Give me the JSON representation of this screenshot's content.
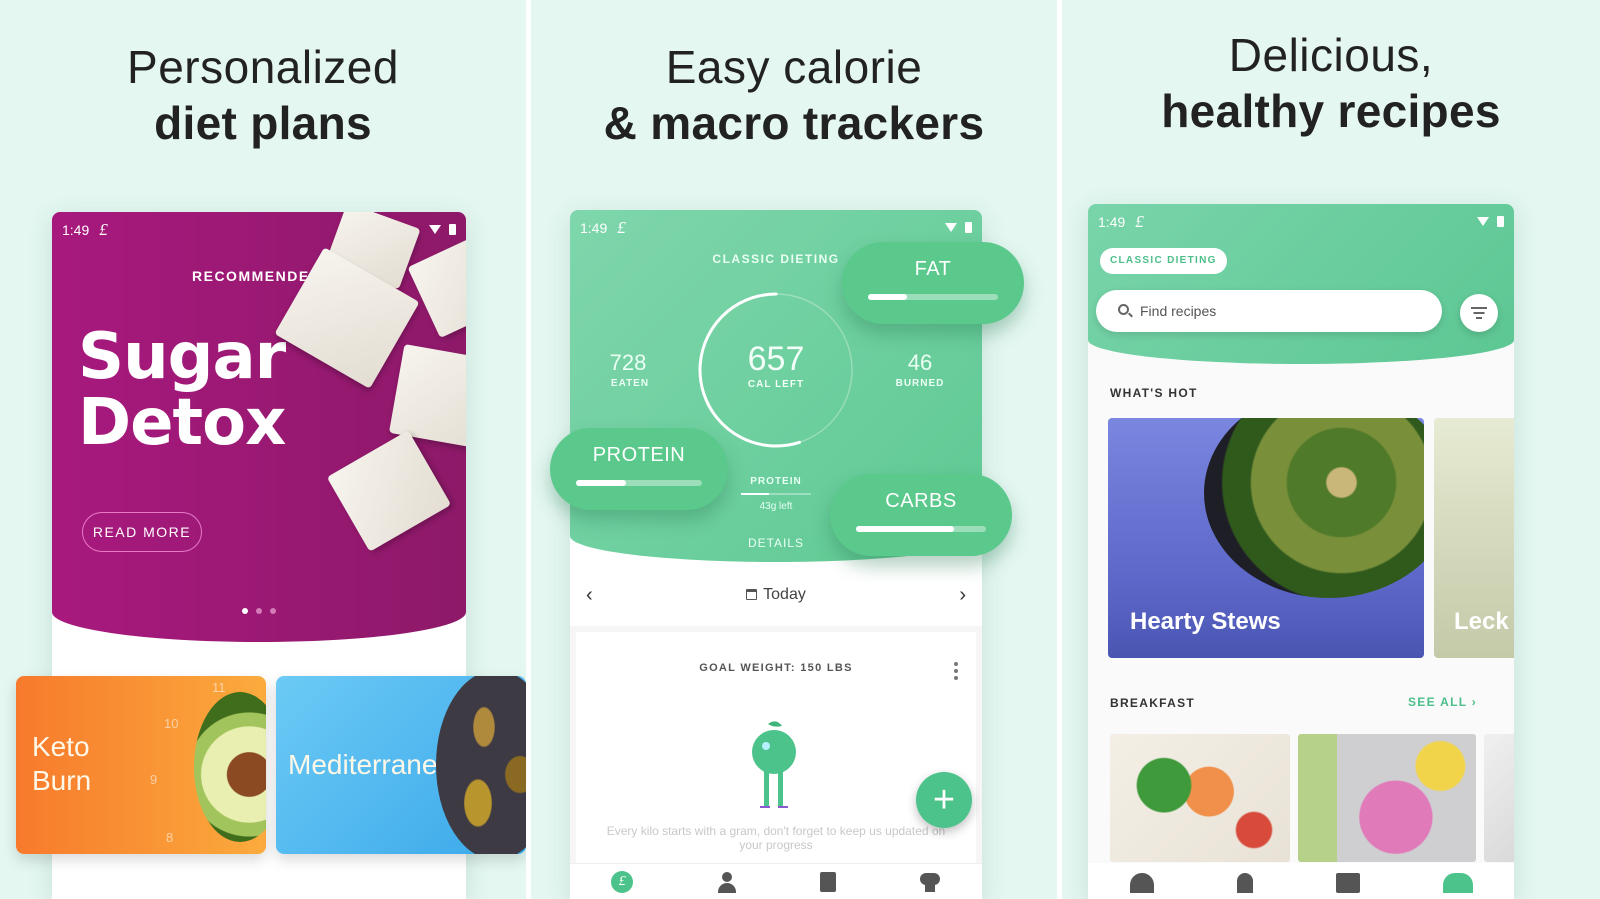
{
  "panels": [
    {
      "headline_light": "Personalized",
      "headline_bold": "diet plans",
      "status_time": "1:49",
      "app_logo": "£",
      "promo": {
        "kicker": "RECOMMENDED",
        "title_line1": "Sugar",
        "title_line2": "Detox",
        "cta_label": "READ MORE",
        "carousel_pages": 3,
        "carousel_active": 1,
        "bg_color": "#a8197e"
      },
      "plans": [
        {
          "line1": "Keto",
          "line2": "Burn",
          "color": "#f77a2c",
          "clock_numbers": [
            "11",
            "10",
            "9",
            "8"
          ]
        },
        {
          "line1": "Mediterranean.",
          "line2": "",
          "color": "#3aa8ea"
        }
      ]
    },
    {
      "headline_light": "Easy calorie",
      "headline_bold": "& macro trackers",
      "status_time": "1:49",
      "app_logo": "£",
      "tracker": {
        "plan_name": "CLASSIC DIETING",
        "eaten_value": "728",
        "eaten_label": "EATEN",
        "left_value": "657",
        "left_label": "CAL LEFT",
        "burned_value": "46",
        "burned_label": "BURNED",
        "ring_progress": 0.55,
        "sub_macro_label": "PROTEIN",
        "sub_macro_value": "43g left",
        "sub_macro_progress": 0.4,
        "details_label": "DETAILS"
      },
      "macros": [
        {
          "name": "FAT",
          "progress": 0.3
        },
        {
          "name": "PROTEIN",
          "progress": 0.4
        },
        {
          "name": "CARBS",
          "progress": 0.75
        }
      ],
      "date_label": "Today",
      "goal_title": "GOAL WEIGHT: 150 LBS",
      "goal_message": "Every kilo starts with a gram, don't forget to keep us updated on your progress",
      "fab_label": "+",
      "accent": "#4cc38a",
      "nav": [
        "home-icon",
        "profile-icon",
        "plan-icon",
        "recipes-icon"
      ]
    },
    {
      "headline_light": "Delicious,",
      "headline_bold": "healthy recipes",
      "status_time": "1:49",
      "app_logo": "£",
      "diet_chip": "CLASSIC DIETING",
      "search_placeholder": "Find recipes",
      "whats_hot_label": "WHAT'S HOT",
      "hot_cards": [
        {
          "title": "Hearty Stews",
          "color": "#6b77d6"
        },
        {
          "title": "Leck",
          "color": "#c9cfae"
        }
      ],
      "breakfast_label": "BREAKFAST",
      "see_all_label": "SEE ALL",
      "accent": "#4cbf89"
    }
  ]
}
